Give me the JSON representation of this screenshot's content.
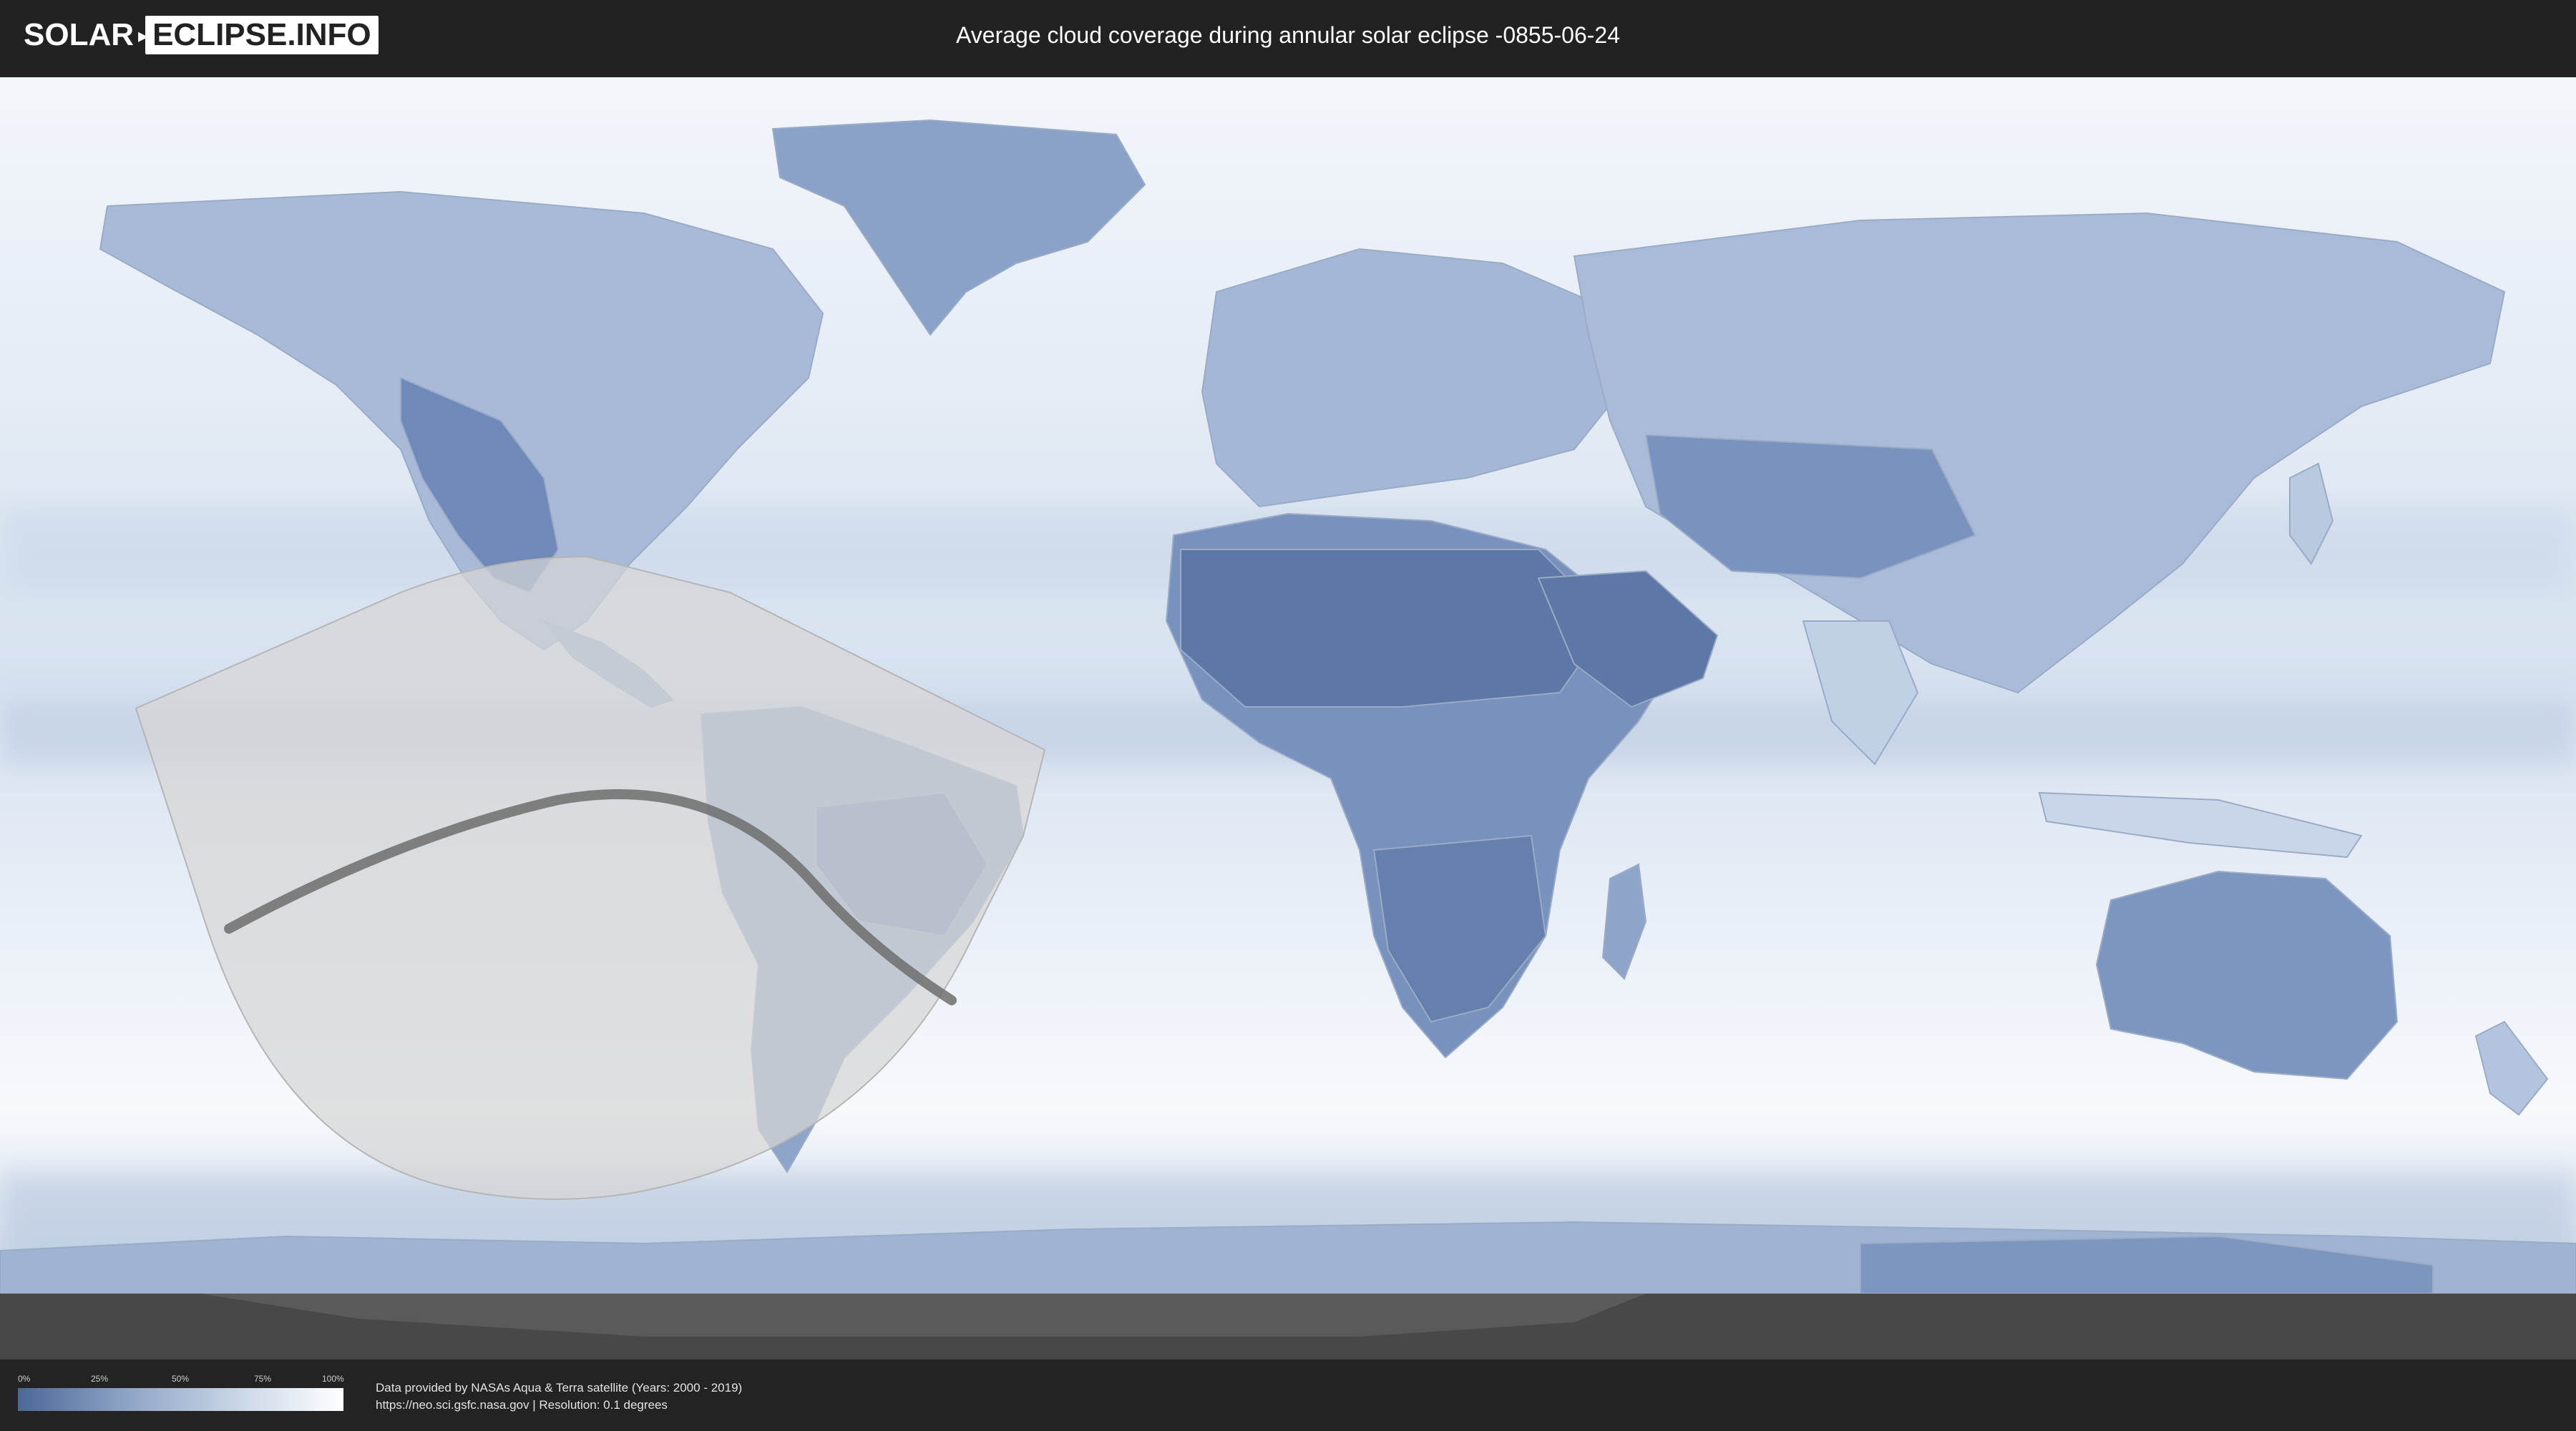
{
  "header": {
    "logo_left": "SOLAR",
    "logo_right": "ECLIPSE.INFO",
    "title": "Average cloud coverage during annular solar eclipse -0855-06-24"
  },
  "map": {
    "ocean_color": "#e6edf6",
    "land_color": "#7f98c2",
    "dry_color": "#5a72a0",
    "eclipse_area_color": "#d5d5d5",
    "eclipse_path_color": "#6d6d6d"
  },
  "legend": {
    "ticks": [
      "0%",
      "25%",
      "50%",
      "75%",
      "100%"
    ]
  },
  "credits": {
    "line1": "Data provided by NASAs Aqua & Terra satellite (Years: 2000 - 2019)",
    "line2": "https://neo.sci.gsfc.nasa.gov | Resolution: 0.1 degrees"
  }
}
